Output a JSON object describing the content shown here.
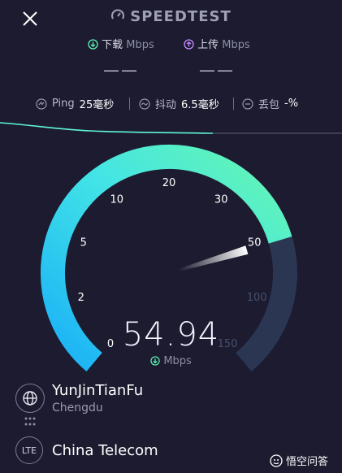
{
  "header": {
    "brand": "SPEEDTEST"
  },
  "results": {
    "download_label": "下载",
    "download_unit": "Mbps",
    "download_value": "——",
    "upload_label": "上传",
    "upload_unit": "Mbps",
    "upload_value": "——"
  },
  "metrics": {
    "ping_label": "Ping",
    "ping_value": "25毫秒",
    "jitter_label": "抖动",
    "jitter_value": "6.5毫秒",
    "loss_label": "丢包",
    "loss_value": "-%"
  },
  "gauge": {
    "ticks": [
      "0",
      "2",
      "5",
      "10",
      "20",
      "30",
      "50",
      "100",
      "150"
    ],
    "current_value": 54.94,
    "current_value_text": "54.94",
    "unit": "Mbps",
    "colors": {
      "start": "#1fb6f5",
      "end": "#5ff7b6",
      "track": "#2b3653",
      "needle": "#ffffff"
    }
  },
  "server": {
    "name": "YunJinTianFu",
    "city": "Chengdu"
  },
  "isp": {
    "badge": "LTE",
    "name": "China Telecom"
  },
  "watermark": {
    "text": "悟空问答"
  }
}
